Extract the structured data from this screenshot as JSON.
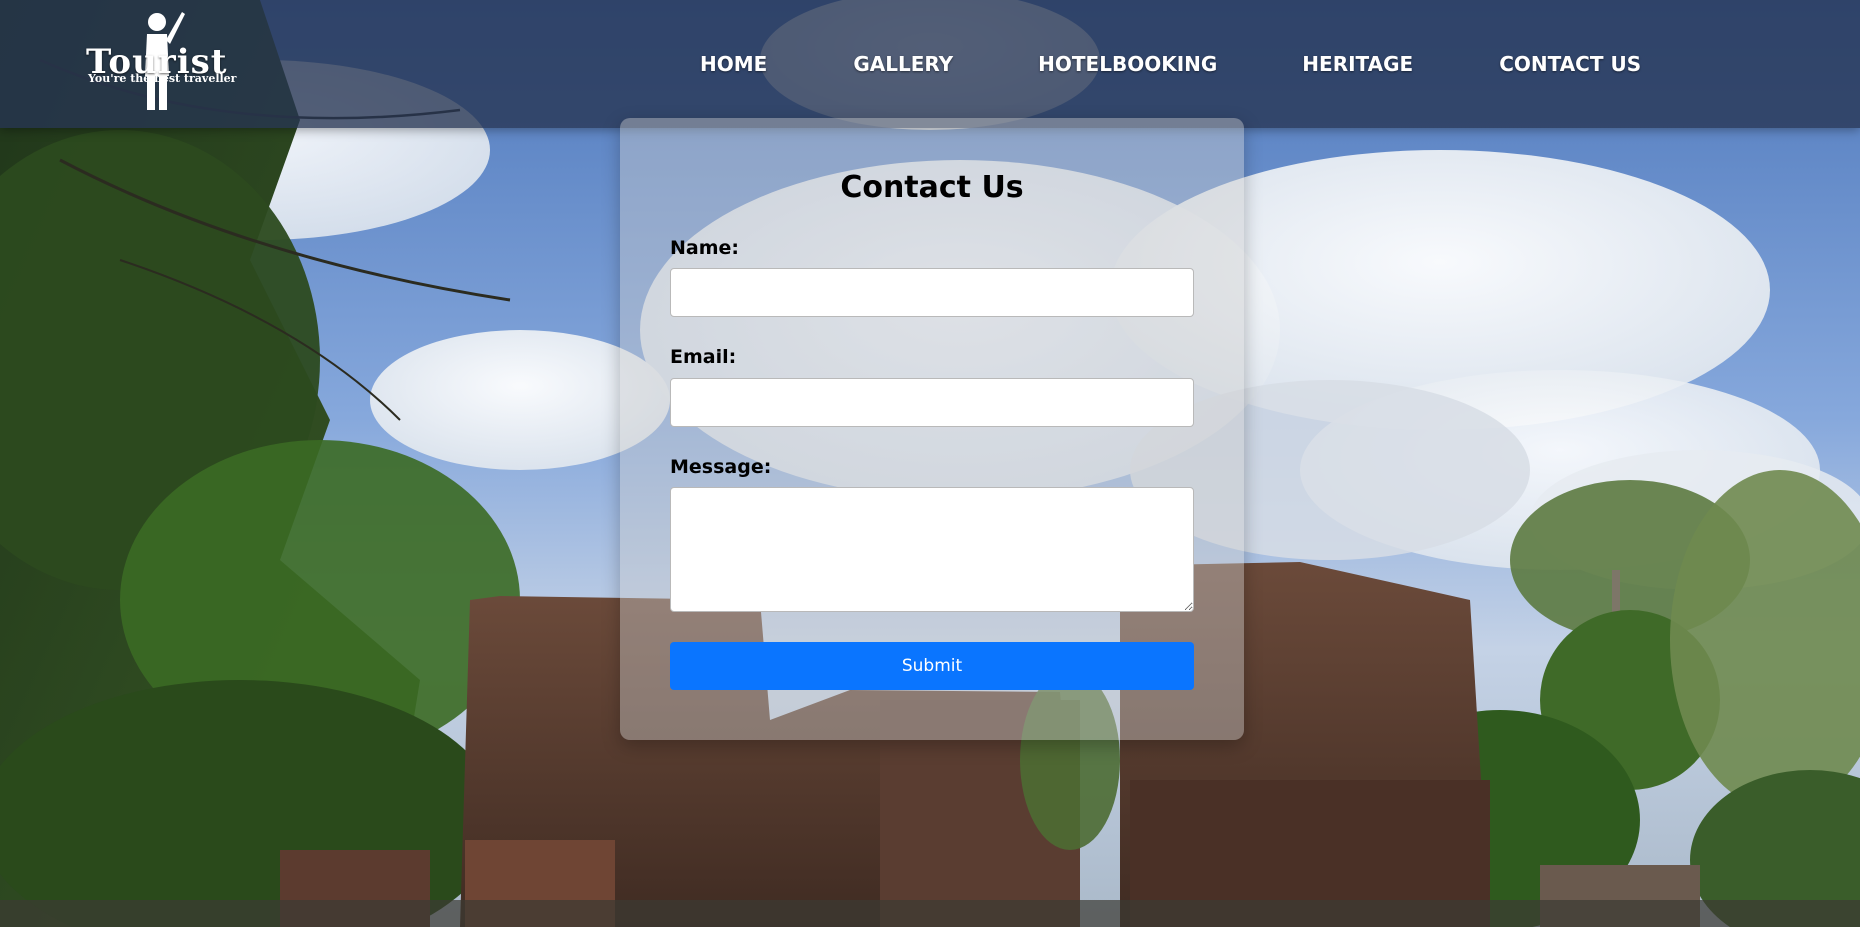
{
  "logo": {
    "wordmark": "Tourist",
    "tagline": "You're the best traveller",
    "icon": "traveller-figure-icon"
  },
  "nav": {
    "items": [
      {
        "label": "HOME"
      },
      {
        "label": "GALLERY"
      },
      {
        "label": "HOTELBOOKING"
      },
      {
        "label": "HERITAGE"
      },
      {
        "label": "CONTACT US"
      }
    ]
  },
  "contact_form": {
    "title": "Contact Us",
    "name_label": "Name:",
    "name_value": "",
    "email_label": "Email:",
    "email_value": "",
    "message_label": "Message:",
    "message_value": "",
    "submit_label": "Submit"
  },
  "colors": {
    "navbar": "#263452",
    "submit_button": "#0a75ff",
    "nav_text": "#ffffff"
  }
}
